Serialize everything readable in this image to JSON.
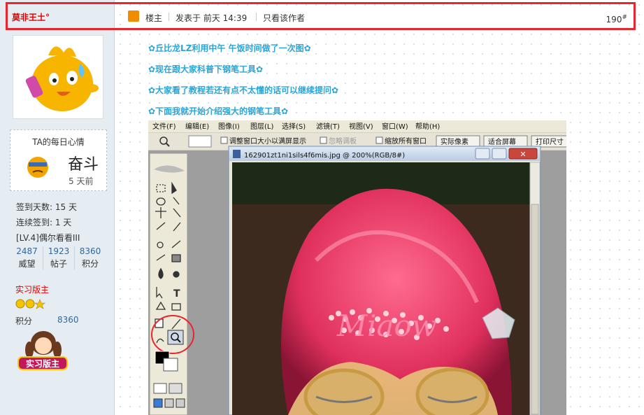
{
  "user": {
    "name": "莫非王土°",
    "mood": {
      "title": "TA的每日心情",
      "word": "奋斗",
      "time": "5 天前"
    },
    "stats": [
      "签到天数: 15 天",
      "连续签到: 1 天",
      "[LV.4]偶尔看看III"
    ],
    "counts": [
      {
        "value": "2487",
        "label": "威望"
      },
      {
        "value": "1923",
        "label": "帖子"
      },
      {
        "value": "8360",
        "label": "积分"
      }
    ],
    "group": "实习版主",
    "score_label": "积分",
    "score_value": "8360",
    "badge_text": "实习版主"
  },
  "post": {
    "role": "楼主",
    "posted": "发表于 前天 14:39",
    "author_only": "只看该作者",
    "floor": "190",
    "floor_mark": "#",
    "lines": [
      "✿丘比龙LZ利用中午 午饭时间做了一次图✿",
      "✿现在跟大家科普下钢笔工具✿",
      "✿大家看了教程若还有点不太懂的话可以继续提问✿",
      "✿下面我就开始介绍强大的钢笔工具✿"
    ]
  },
  "photoshop": {
    "menu": [
      "文件(F)",
      "编辑(E)",
      "图像(I)",
      "图层(L)",
      "选择(S)",
      "滤镜(T)",
      "视图(V)",
      "窗口(W)",
      "帮助(H)"
    ],
    "options": [
      "调整窗口大小以满屏显示",
      "忽略调板",
      "缩放所有窗口"
    ],
    "buttons": [
      "实际像素",
      "适合屏幕",
      "打印尺寸"
    ],
    "doc_title": "162901zt1ni1sils4f6mis.jpg @ 200%(RGB/8#)",
    "hair_text": "Miaow"
  },
  "colors": {
    "highlight": "#e8262e",
    "link": "#2aa5d8",
    "username": "#dd0000"
  }
}
